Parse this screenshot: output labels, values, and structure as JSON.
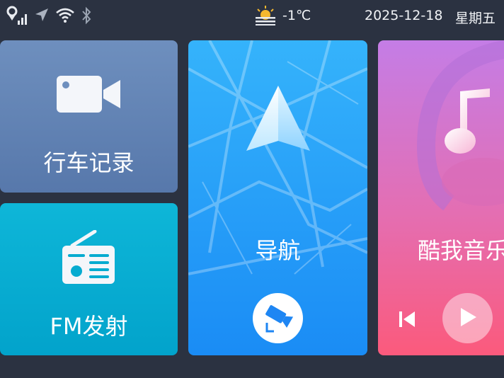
{
  "status_bar": {
    "weather_temp": "-1℃",
    "date": "2025-12-18",
    "weekday": "星期五"
  },
  "tiles": {
    "dashcam": {
      "label": "行车记录"
    },
    "fm": {
      "label": "FM发射"
    },
    "navigation": {
      "label": "导航"
    },
    "music": {
      "label": "酷我音乐"
    }
  },
  "colors": {
    "background": "#2b3241",
    "dashcam": "#6584b6",
    "fm": "#06abd0",
    "navigation": "#259ef8",
    "music_top": "#c47de6",
    "music_bottom": "#fb5a7c"
  },
  "icons": [
    "location-signal-icon",
    "navigation-arrow-icon",
    "wifi-icon",
    "bluetooth-icon",
    "weather-sun-icon",
    "video-camera-icon",
    "radio-icon",
    "nav-arrow-icon",
    "dashcam-icon",
    "music-note-icon",
    "previous-track-icon",
    "play-icon"
  ]
}
